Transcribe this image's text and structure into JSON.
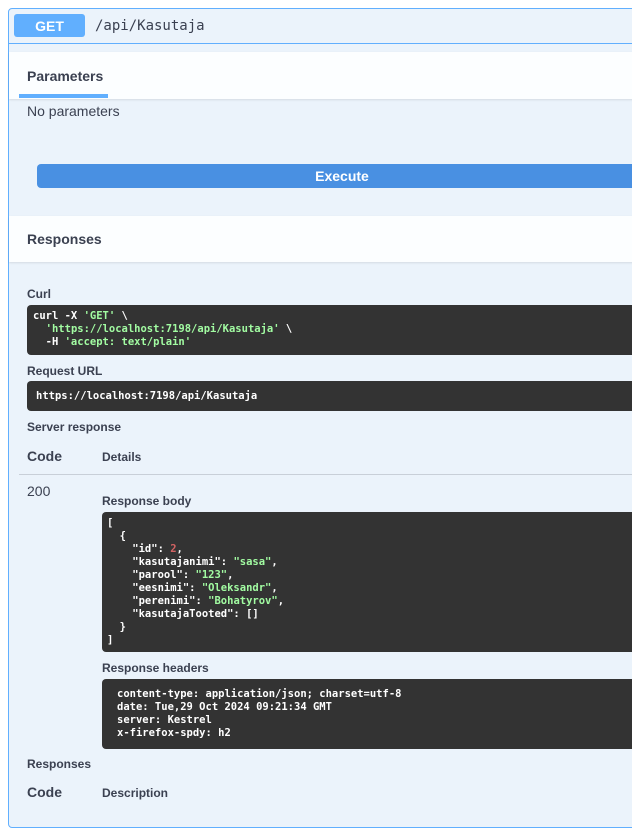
{
  "operation": {
    "method": "GET",
    "path": "/api/Kasutaja"
  },
  "parameters": {
    "tab_label": "Parameters",
    "empty_text": "No parameters",
    "execute_label": "Execute"
  },
  "responses_section": {
    "title": "Responses",
    "curl_label": "Curl",
    "curl_line1_prefix": "curl -X ",
    "curl_method": "'GET'",
    "curl_line1_suffix": " \\",
    "curl_line2_indent": "  ",
    "curl_url": "'https://localhost:7198/api/Kasutaja'",
    "curl_line2_suffix": " \\",
    "curl_line3_prefix": "  -H ",
    "curl_header": "'accept: text/plain'",
    "request_url_label": "Request URL",
    "request_url": "https://localhost:7198/api/Kasutaja",
    "server_response_label": "Server response",
    "code_col": "Code",
    "details_col": "Details",
    "status_code": "200",
    "response_body_label": "Response body",
    "response_headers_label": "Response headers",
    "headers": [
      "content-type: application/json; charset=utf-8",
      "date: Tue,29 Oct 2024 09:21:34 GMT",
      "server: Kestrel",
      "x-firefox-spdy: h2"
    ],
    "responses_label": "Responses",
    "description_col": "Description"
  },
  "response_body": {
    "id": "2",
    "kasutajanimi": "\"sasa\"",
    "parool": "\"123\"",
    "eesnimi": "\"Oleksandr\"",
    "perenimi": "\"Bohatyrov\"",
    "kasutajaTooted": "[]"
  }
}
